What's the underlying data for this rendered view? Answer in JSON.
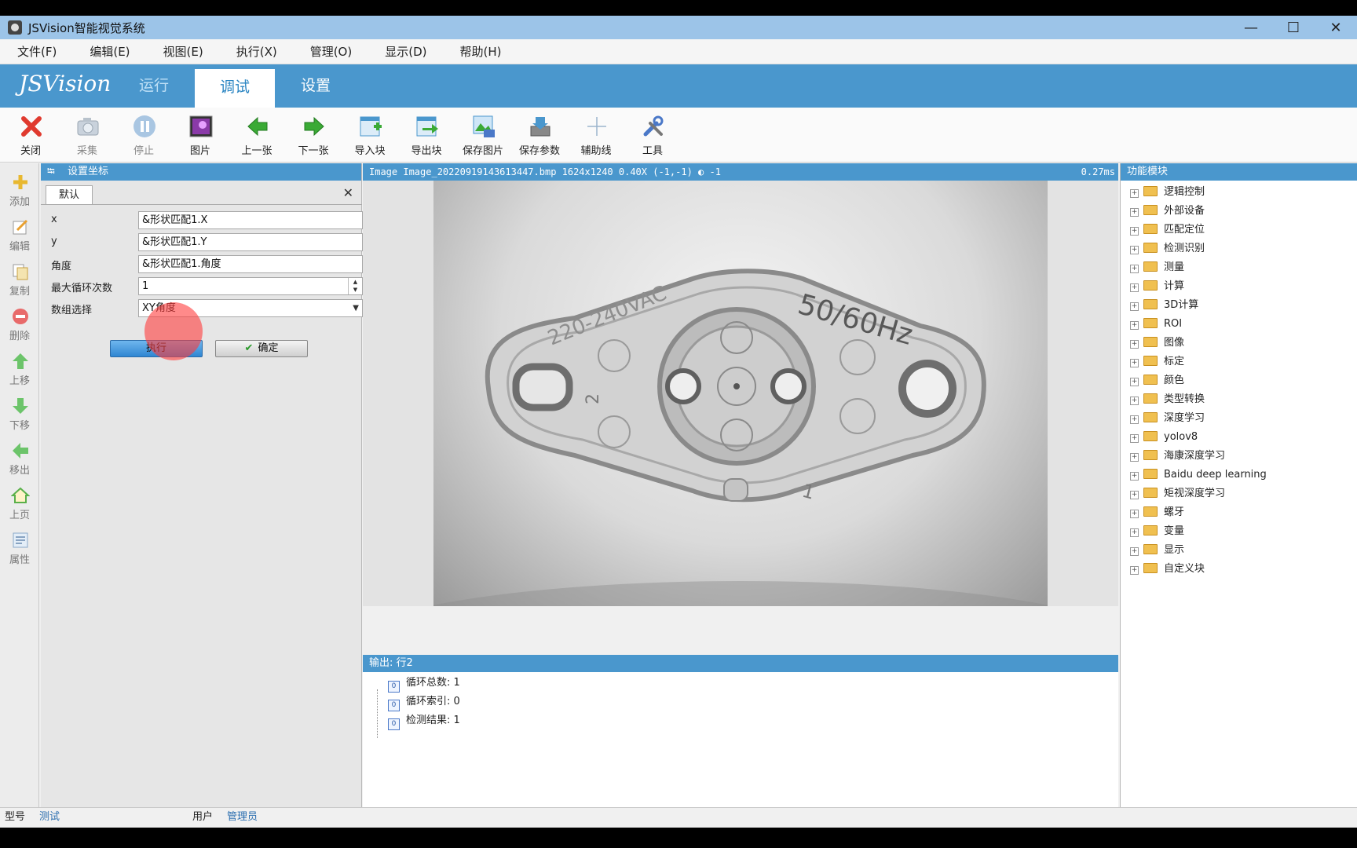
{
  "window": {
    "title": "JSVision智能视觉系统",
    "minimize": "—",
    "maximize": "☐",
    "close": "✕"
  },
  "menu": [
    "文件(F)",
    "编辑(E)",
    "视图(E)",
    "执行(X)",
    "管理(O)",
    "显示(D)",
    "帮助(H)"
  ],
  "nav": {
    "brand": "JSVision",
    "tabs": [
      "运行",
      "调试",
      "设置"
    ],
    "active_tab": "调试"
  },
  "toolbar": [
    {
      "label": "关闭",
      "icon": "close-icon"
    },
    {
      "label": "采集",
      "icon": "camera-icon"
    },
    {
      "label": "停止",
      "icon": "pause-icon"
    },
    {
      "label": "图片",
      "icon": "picture-icon"
    },
    {
      "label": "上一张",
      "icon": "arrow-left-icon"
    },
    {
      "label": "下一张",
      "icon": "arrow-right-icon"
    },
    {
      "label": "导入块",
      "icon": "import-block-icon"
    },
    {
      "label": "导出块",
      "icon": "export-block-icon"
    },
    {
      "label": "保存图片",
      "icon": "save-image-icon"
    },
    {
      "label": "保存参数",
      "icon": "save-params-icon"
    },
    {
      "label": "辅助线",
      "icon": "guide-line-icon"
    },
    {
      "label": "工具",
      "icon": "tools-icon"
    }
  ],
  "sidebar": [
    {
      "label": "添加",
      "icon": "add-icon"
    },
    {
      "label": "编辑",
      "icon": "edit-icon"
    },
    {
      "label": "复制",
      "icon": "copy-icon"
    },
    {
      "label": "删除",
      "icon": "delete-icon"
    },
    {
      "label": "上移",
      "icon": "move-up-icon"
    },
    {
      "label": "下移",
      "icon": "move-down-icon"
    },
    {
      "label": "移出",
      "icon": "move-out-icon"
    },
    {
      "label": "上页",
      "icon": "home-icon"
    },
    {
      "label": "属性",
      "icon": "properties-icon"
    }
  ],
  "panel": {
    "title": "设置坐标",
    "tab": "默认",
    "close": "✕",
    "fields": [
      {
        "label": "x",
        "value": "&形状匹配1.X"
      },
      {
        "label": "y",
        "value": "&形状匹配1.Y"
      },
      {
        "label": "角度",
        "value": "&形状匹配1.角度"
      },
      {
        "label": "最大循环次数",
        "value": "1"
      },
      {
        "label": "数组选择",
        "value": "XY角度"
      }
    ],
    "exec_button": "执行",
    "ok_button": "确定"
  },
  "image_view": {
    "info": "Image Image_20220919143613447.bmp 1624x1240 0.40X (-1,-1)",
    "pixel_value": "-1",
    "time": "0.27ms",
    "part_text_left": "220-240VAC",
    "part_text_right": "50/60Hz",
    "part_mark_2": "2",
    "part_mark_1": "1"
  },
  "output": {
    "title": "输出: 行2",
    "icon_glyph": "0",
    "items": [
      "循环总数: 1",
      "循环索引: 0",
      "检测结果: 1"
    ]
  },
  "modules": {
    "title": "功能模块",
    "items": [
      "逻辑控制",
      "外部设备",
      "匹配定位",
      "检测识别",
      "测量",
      "计算",
      "3D计算",
      "ROI",
      "图像",
      "标定",
      "颜色",
      "类型转换",
      "深度学习",
      "yolov8",
      "海康深度学习",
      "Baidu deep learning",
      "矩视深度学习",
      "螺牙",
      "变量",
      "显示",
      "自定义块"
    ]
  },
  "status": {
    "model_label": "型号",
    "model_value": "测试",
    "user_label": "用户",
    "user_value": "管理员"
  },
  "colors": {
    "accent": "#4a97cd",
    "title_bar": "#9cc4e8",
    "close_red": "#e03a2f",
    "arrow_green": "#3aaa35"
  }
}
